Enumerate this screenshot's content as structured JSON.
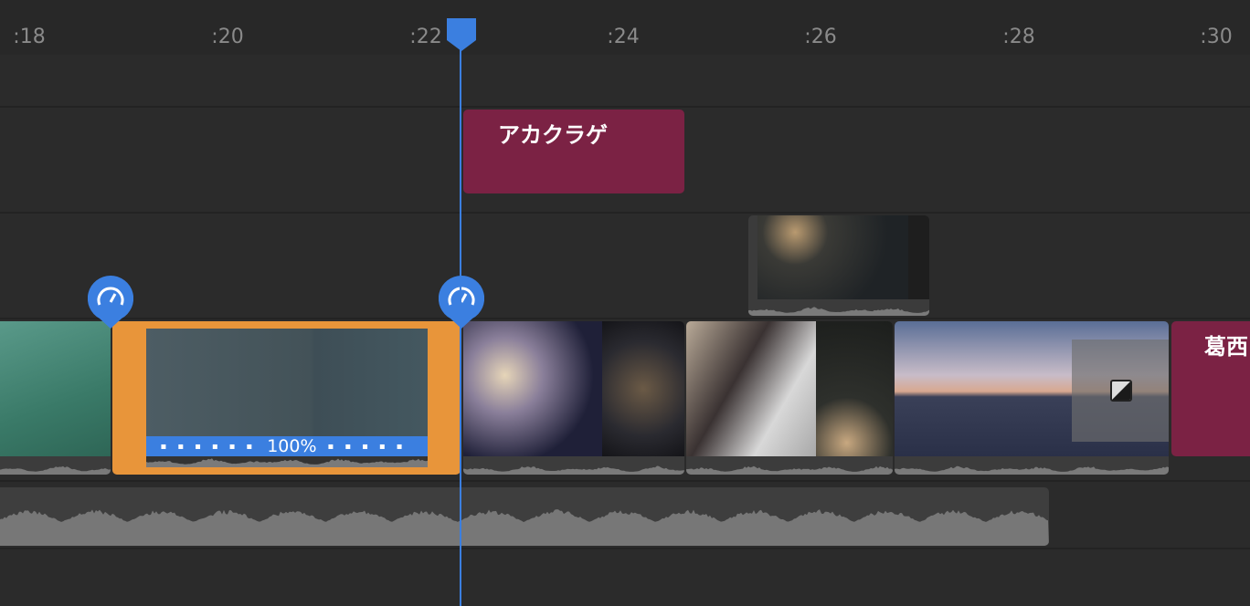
{
  "ruler": {
    "ticks": [
      ":18",
      ":20",
      ":22",
      ":24",
      ":26",
      ":28",
      ":30"
    ]
  },
  "titles": {
    "title1": "アカクラゲ",
    "title2": "葛西"
  },
  "selected_clip": {
    "speed_label": "100%"
  },
  "colors": {
    "accent": "#3b7fe0",
    "selection": "#e8953a",
    "title": "#7b2244"
  },
  "icons": {
    "speed_marker": "speedometer-icon",
    "transition": "transition-icon"
  }
}
